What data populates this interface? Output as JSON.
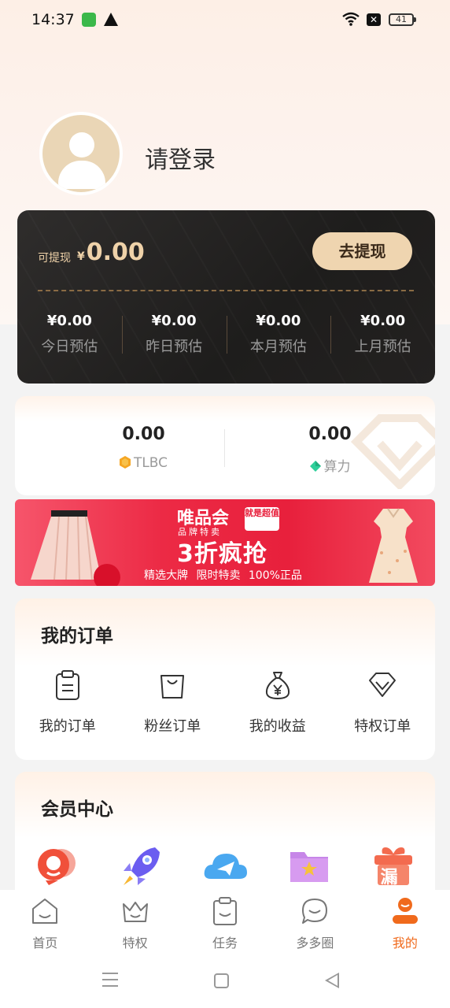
{
  "status_bar": {
    "time": "14:37",
    "battery": "41",
    "icons": [
      "app-notification-icon",
      "warning-icon",
      "wifi-icon",
      "sim-off-icon",
      "battery-icon"
    ]
  },
  "profile": {
    "login_prompt": "请登录",
    "avatar_icon": "user-avatar-icon"
  },
  "earnings": {
    "withdrawable_label": "可提现",
    "currency": "¥",
    "withdrawable_amount": "0.00",
    "withdraw_button": "去提现",
    "stats": [
      {
        "value": "¥0.00",
        "label": "今日预估"
      },
      {
        "value": "¥0.00",
        "label": "昨日预估"
      },
      {
        "value": "¥0.00",
        "label": "本月预估"
      },
      {
        "value": "¥0.00",
        "label": "上月预估"
      }
    ]
  },
  "tokens": [
    {
      "value": "0.00",
      "label": "TLBC",
      "icon": "tlbc-coin-icon"
    },
    {
      "value": "0.00",
      "label": "算力",
      "icon": "compute-power-icon"
    }
  ],
  "banner": {
    "brand": "唯品会",
    "brand_sub": "品牌特卖",
    "tag": "就是超值",
    "headline": "3折疯抢",
    "footer": "精选大牌 限时特卖 100%正品"
  },
  "orders": {
    "title": "我的订单",
    "items": [
      {
        "label": "我的订单",
        "icon": "clipboard-icon"
      },
      {
        "label": "粉丝订单",
        "icon": "shopping-bag-icon"
      },
      {
        "label": "我的收益",
        "icon": "money-bag-icon"
      },
      {
        "label": "特权订单",
        "icon": "diamond-icon"
      }
    ]
  },
  "members": {
    "title": "会员中心",
    "icons": [
      "customer-service-icon",
      "rocket-icon",
      "cloud-send-icon",
      "star-folder-icon",
      "gift-leak-icon"
    ],
    "gift_char": "漏"
  },
  "bottom_nav": {
    "items": [
      {
        "label": "首页",
        "icon": "home-icon"
      },
      {
        "label": "特权",
        "icon": "crown-icon"
      },
      {
        "label": "任务",
        "icon": "task-clipboard-icon"
      },
      {
        "label": "多多圈",
        "icon": "chat-bubble-icon"
      },
      {
        "label": "我的",
        "icon": "profile-icon"
      }
    ],
    "active": "我的"
  },
  "colors": {
    "accent": "#f06a1c",
    "gold": "#efd2a9",
    "card_dark": "#1e1d1c",
    "banner_red": "#e8203c"
  }
}
